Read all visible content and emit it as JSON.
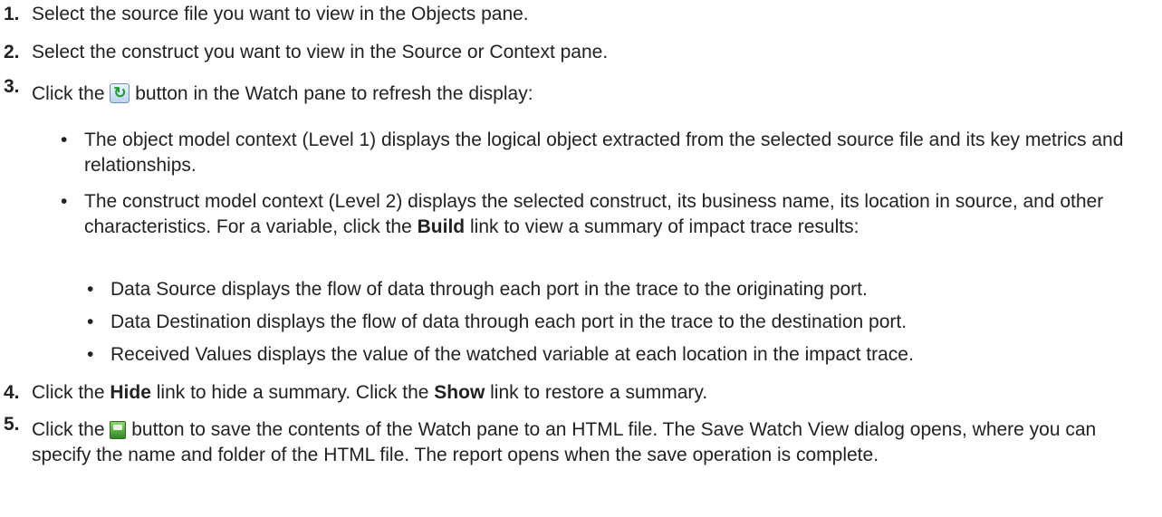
{
  "steps": [
    {
      "num": "1.",
      "text": "Select the source file you want to view in the Objects pane."
    },
    {
      "num": "2.",
      "text": "Select the construct you want to view in the Source or Context pane."
    },
    {
      "num": "3.",
      "pre": "Click the",
      "icon": "refresh-icon",
      "post": "button in the Watch pane to refresh the display:"
    },
    {
      "num": "4.",
      "a": "Click the",
      "b1": "Hide",
      "c": "link to hide a summary. Click the",
      "b2": "Show",
      "d": "link to restore a summary."
    },
    {
      "num": "5.",
      "pre": "Click the",
      "icon": "save-icon",
      "post": "button to save the contents of the Watch pane to an HTML file. The Save Watch View dialog opens, where you can specify the name and folder of the HTML file. The report opens when the save operation is complete."
    }
  ],
  "level1": [
    {
      "text": "The object model context (Level 1) displays the logical object extracted from the selected source file and its key metrics and relationships."
    },
    {
      "pre": "The construct model context (Level 2) displays the selected construct, its business name, its location in source, and other characteristics. For a variable, click the",
      "bold": "Build",
      "post": "link to view a summary of impact trace results:"
    }
  ],
  "level2": [
    "Data Source displays the flow of data through each port in the trace to the originating port.",
    "Data Destination displays the flow of data through each port in the trace to the destination port.",
    "Received Values displays the value of the watched variable at each location in the impact trace."
  ],
  "bullet": "•"
}
